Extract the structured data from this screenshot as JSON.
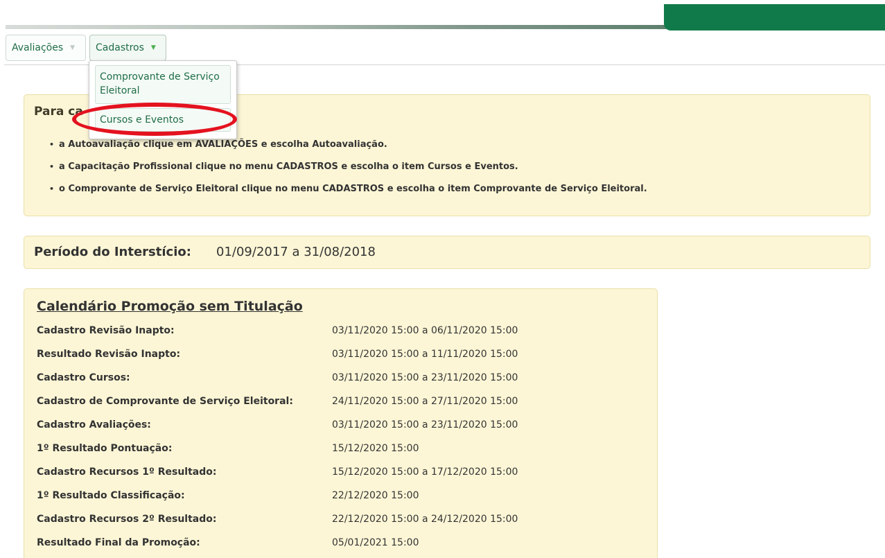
{
  "menu": {
    "items": [
      {
        "label": "Avaliações"
      },
      {
        "label": "Cadastros"
      }
    ],
    "dropdown": [
      {
        "label": "Comprovante de Serviço Eleitoral"
      },
      {
        "label": "Cursos e Eventos"
      }
    ]
  },
  "info": {
    "heading": "Para ca",
    "bullets": [
      "a Autoavaliação clique em AVALIAÇÕES e escolha Autoavaliação.",
      "a Capacitação Profissional clique no menu CADASTROS e escolha o item Cursos e Eventos.",
      "o Comprovante de Serviço Eleitoral clique no menu CADASTROS e escolha o item Comprovante de Serviço Eleitoral."
    ]
  },
  "period": {
    "label": "Período do Interstício:",
    "value": "01/09/2017 a 31/08/2018"
  },
  "calendar": {
    "title": "Calendário Promoção sem Titulação",
    "rows": [
      {
        "label": "Cadastro Revisão Inapto:",
        "value": "03/11/2020 15:00 a 06/11/2020 15:00"
      },
      {
        "label": "Resultado Revisão Inapto:",
        "value": "03/11/2020 15:00 a 11/11/2020 15:00"
      },
      {
        "label": "Cadastro Cursos:",
        "value": "03/11/2020 15:00 a 23/11/2020 15:00"
      },
      {
        "label": "Cadastro de Comprovante de Serviço Eleitoral:",
        "value": "24/11/2020 15:00 a 27/11/2020 15:00"
      },
      {
        "label": "Cadastro Avaliações:",
        "value": "03/11/2020 15:00 a 23/11/2020 15:00"
      },
      {
        "label": "1º Resultado Pontuação:",
        "value": "15/12/2020 15:00"
      },
      {
        "label": "Cadastro Recursos 1º Resultado:",
        "value": "15/12/2020 15:00 a 17/12/2020 15:00"
      },
      {
        "label": "1º Resultado Classificação:",
        "value": "22/12/2020 15:00"
      },
      {
        "label": "Cadastro Recursos 2º Resultado:",
        "value": "22/12/2020 15:00 a 24/12/2020 15:00"
      },
      {
        "label": "Resultado Final da Promoção:",
        "value": "05/01/2021 15:00"
      }
    ]
  },
  "colors": {
    "brand_green": "#117a4a",
    "menu_text": "#1f6d47",
    "box_background": "#fcf6d6",
    "highlight_ring": "#e4121f"
  }
}
